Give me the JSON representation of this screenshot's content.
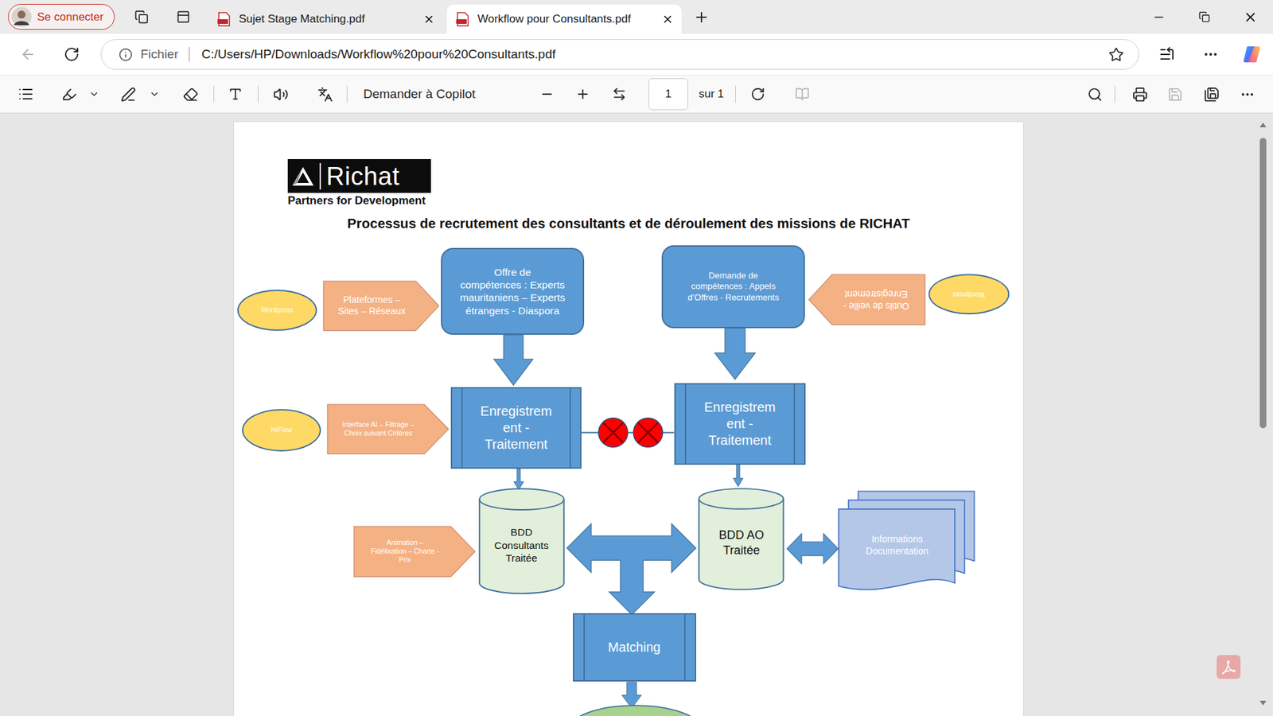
{
  "browser": {
    "profile": {
      "label": "Se connecter"
    },
    "tabs": [
      {
        "label": "Sujet Stage Matching.pdf",
        "selected": false
      },
      {
        "label": "Workflow pour Consultants.pdf",
        "selected": true
      }
    ]
  },
  "address_bar": {
    "back_disabled": true,
    "scheme": "Fichier",
    "url": "C:/Users/HP/Downloads/Workflow%20pour%20Consultants.pdf"
  },
  "pdf_toolbar": {
    "copilot": "Demander à Copilot",
    "page": "1",
    "total": "sur 1",
    "two_page_disabled": true,
    "save_disabled": true
  },
  "document": {
    "logo": {
      "name": "Richat",
      "tagline": "Partners for Development"
    },
    "title": "Processus de recrutement des consultants et de déroulement des missions de RICHAT",
    "diagram": {
      "source_left_tool": {
        "lines": [
          "Wordpress"
        ]
      },
      "source_left": {
        "lines": [
          "Plateformes –",
          "Sites – Réseaux"
        ]
      },
      "offer": {
        "lines": [
          "Offre de",
          "compétences : Experts",
          "mauritaniens – Experts",
          "étrangers - Diaspora"
        ]
      },
      "demand": {
        "lines": [
          "Demande de",
          "compétences : Appels",
          "d’Offres - Recrutements"
        ]
      },
      "watch": {
        "lines": [
          "Outils de veille -",
          "Enregistrement"
        ]
      },
      "source_right_tool": {
        "lines": [
          "Wordpress"
        ]
      },
      "filter_tool": {
        "lines": [
          "HrFlow"
        ]
      },
      "filter": {
        "lines": [
          "Interface AI – Filtrage –",
          "Choix suivant Critères"
        ]
      },
      "processing_left": {
        "lines": [
          "Enregistrem",
          "ent -",
          "Traitement"
        ]
      },
      "processing_right": {
        "lines": [
          "Enregistrem",
          "ent -",
          "Traitement"
        ]
      },
      "db_consultants": {
        "lines": [
          "BDD",
          "Consultants",
          "Traitée"
        ]
      },
      "db_ao": {
        "lines": [
          "BDD AO",
          "Traitée"
        ]
      },
      "animation": {
        "lines": [
          "Animation –",
          "Fidélisation – Charte -",
          "Prix"
        ]
      },
      "documentation": {
        "lines": [
          "Informations",
          "Documentation"
        ]
      },
      "matching": {
        "lines": [
          "Matching"
        ]
      }
    }
  }
}
